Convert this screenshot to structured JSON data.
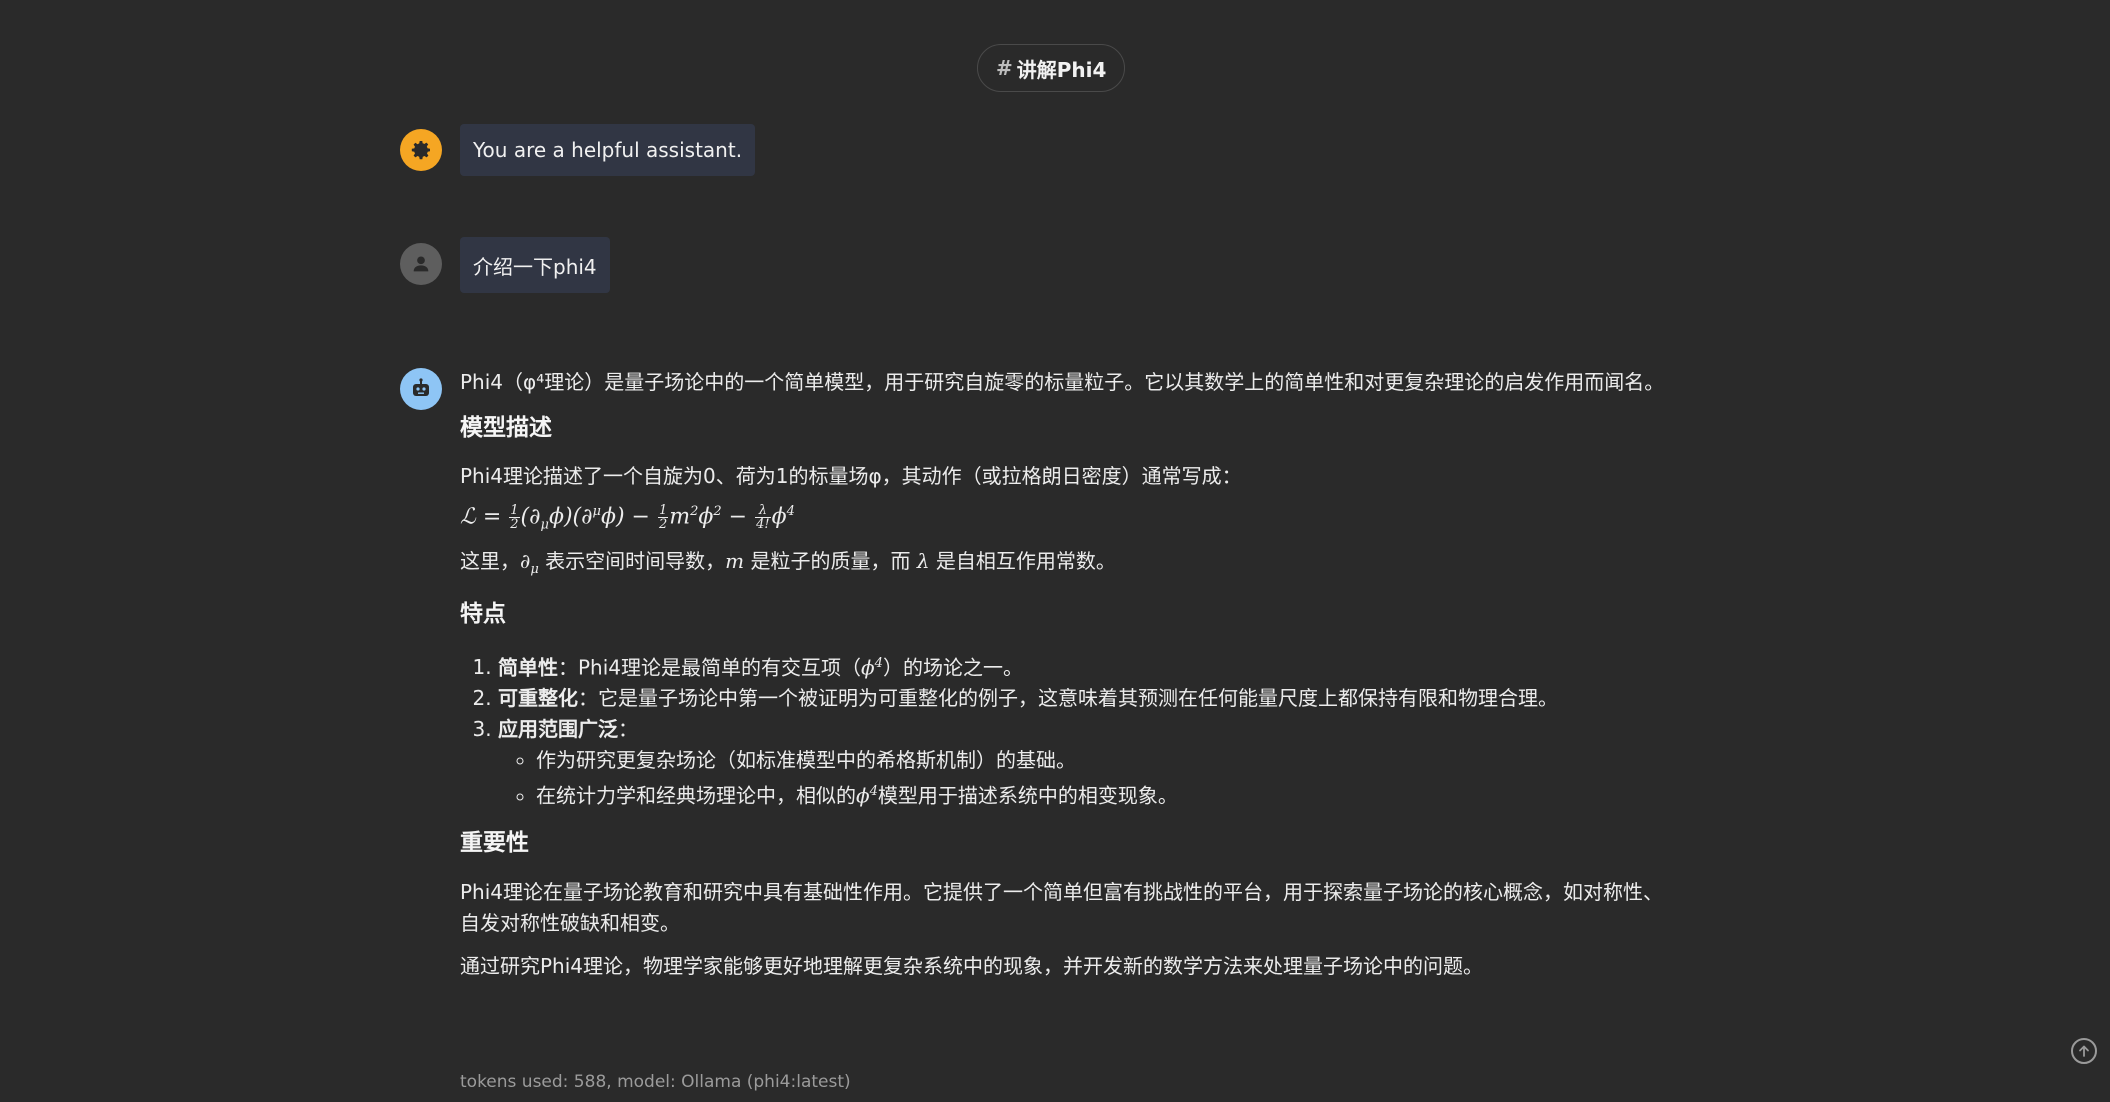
{
  "header": {
    "hash": "#",
    "title": "讲解Phi4"
  },
  "messages": {
    "system": {
      "role_icon": "gear-icon",
      "text": "You are a helpful assistant."
    },
    "user": {
      "role_icon": "person-icon",
      "text": "介绍一下phi4"
    },
    "assistant": {
      "role_icon": "robot-icon",
      "intro": "Phi4（φ⁴理论）是量子场论中的一个简单模型，用于研究自旋零的标量粒子。它以其数学上的简单性和对更复杂理论的启发作用而闻名。",
      "section1": {
        "heading": "模型描述",
        "para": "Phi4理论描述了一个自旋为0、荷为1的标量场φ，其动作（或拉格朗日密度）通常写成：",
        "formula": {
          "lhs": "ℒ = ",
          "half_num": "1",
          "half_den": "2",
          "kinetic": "(∂",
          "mu_sub": "μ",
          "kinetic2": "ϕ)(∂",
          "mu_sup": "μ",
          "kinetic3": "ϕ) − ",
          "half2_num": "1",
          "half2_den": "2",
          "mass_term": "m",
          "two_sup": "2",
          "phi": "ϕ",
          "two_sup2": "2",
          "minus": " − ",
          "lambda_num": "λ",
          "lambda_den": "4!",
          "phi4": "ϕ",
          "four_sup": "4"
        },
        "explain_pre": "这里，",
        "explain_del": "∂",
        "explain_mu": "μ",
        "explain_1": " 表示空间时间导数，",
        "explain_m": "m",
        "explain_2": " 是粒子的质量，而 ",
        "explain_lambda": "λ",
        "explain_3": " 是自相互作用常数。"
      },
      "section2": {
        "heading": "特点",
        "items": [
          {
            "bold": "简单性",
            "text_pre": "：Phi4理论是最简单的有交互项（",
            "math": "ϕ",
            "sup": "4",
            "text_post": "）的场论之一。"
          },
          {
            "bold": "可重整化",
            "text": "：它是量子场论中第一个被证明为可重整化的例子，这意味着其预测在任何能量尺度上都保持有限和物理合理。"
          },
          {
            "bold": "应用范围广泛",
            "text": "："
          }
        ],
        "subitems": [
          {
            "text": "作为研究更复杂场论（如标准模型中的希格斯机制）的基础。"
          },
          {
            "text_pre": "在统计力学和经典场理论中，相似的",
            "math": "ϕ",
            "sup": "4",
            "text_post": "模型用于描述系统中的相变现象。"
          }
        ]
      },
      "section3": {
        "heading": "重要性",
        "para1": "Phi4理论在量子场论教育和研究中具有基础性作用。它提供了一个简单但富有挑战性的平台，用于探索量子场论的核心概念，如对称性、自发对称性破缺和相变。",
        "para2": "通过研究Phi4理论，物理学家能够更好地理解更复杂系统中的现象，并开发新的数学方法来处理量子场论中的问题。"
      }
    }
  },
  "footer": {
    "info": "tokens used: 588, model: Ollama (phi4:latest)"
  },
  "colors": {
    "background": "#2a2a2a",
    "bubble": "#313644",
    "system_avatar": "#f5a623",
    "user_avatar": "#5e5e5e",
    "assistant_avatar": "#8ec5f5"
  }
}
